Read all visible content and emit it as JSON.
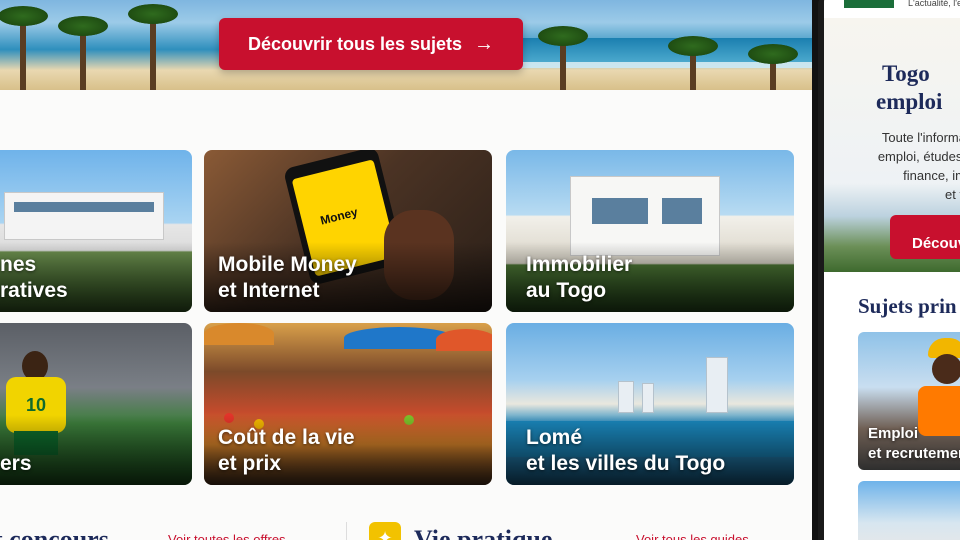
{
  "desktop": {
    "hero": {
      "cta_label": "Découvrir tous les sujets",
      "cta_icon": "arrow-right-icon"
    },
    "cards": [
      {
        "line1": "nes",
        "line2": "ratives"
      },
      {
        "line1": "Mobile Money",
        "line2": "et Internet",
        "phone_text": "Money"
      },
      {
        "line1": "Immobilier",
        "line2": "au Togo"
      },
      {
        "line1": "ers",
        "line2": "",
        "jersey_number": "10"
      },
      {
        "line1": "Coût de la vie",
        "line2": "et prix"
      },
      {
        "line1": "Lomé",
        "line2": "et les villes du Togo"
      }
    ],
    "sections": {
      "left_title": "t concours",
      "left_link": "Voir toutes les offres →",
      "right_title": "Vie pratique",
      "right_link": "Voir tous les guides →"
    },
    "colors": {
      "brand_red": "#c8102e",
      "navy": "#1d2a5a",
      "accent_yellow": "#f2c200"
    }
  },
  "mobile": {
    "tagline": "L'actualité, l'exp",
    "title_l1": "Togo",
    "title_l2": "emploi",
    "desc": [
      "Toute l'informa",
      "emploi, études,",
      "finance, im",
      "et v"
    ],
    "cta_label": "Découv",
    "section_title": "Sujets prin",
    "card1_l1": "Emploi",
    "card1_l2": "et recrutemen"
  }
}
